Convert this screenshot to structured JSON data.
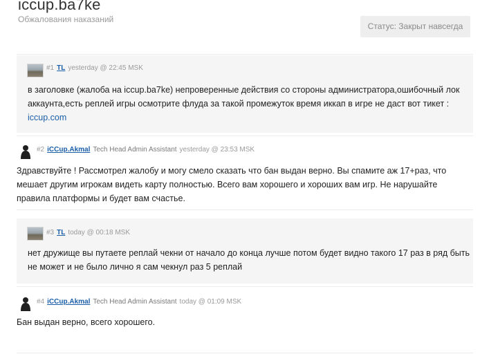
{
  "topic": {
    "title": "iccup.ba7ke",
    "subtitle": "Обжалования наказаний",
    "status": "Статус: Закрыт навсегда"
  },
  "posts": [
    {
      "number": "#1",
      "author": "TL",
      "role": "",
      "time": "yesterday @ 22:45 MSK",
      "text": "в заголовке (жалоба на iccup.ba7ke) непроверенные действия со стороны администратора,ошибочный лок аккаунта,есть реплей игры осмотрите флуда за такой промежуток время иккап в игре не даст вот тикет :",
      "link": "iccup.com"
    },
    {
      "number": "#2",
      "author": "iCCup.Akmal",
      "role": "Tech Head Admin Assistant",
      "time": "yesterday @ 23:53 MSK",
      "text": "Здравствуйте ! Рассмотрел жалобу и могу смело сказать что бан выдан верно. Вы спамите аж 17+раз, что мешает другим игрокам видеть карту полностью. Всего вам хорошего и хороших вам игр. Не нарушайте правила платформы и будет вам счастье."
    },
    {
      "number": "#3",
      "author": "TL",
      "role": "",
      "time": "today @ 00:18 MSK",
      "text": "нет дружище вы путаете реплай чекни от начало до конца лучше потом будет видно такого 17 раз в ряд быть не может и не было лично я сам чекнул раз 5 реплай"
    },
    {
      "number": "#4",
      "author": "iCCup.Akmal",
      "role": "Tech Head Admin Assistant",
      "time": "today @ 01:09 MSK",
      "text": "Бан выдан верно, всего хорошего."
    }
  ]
}
